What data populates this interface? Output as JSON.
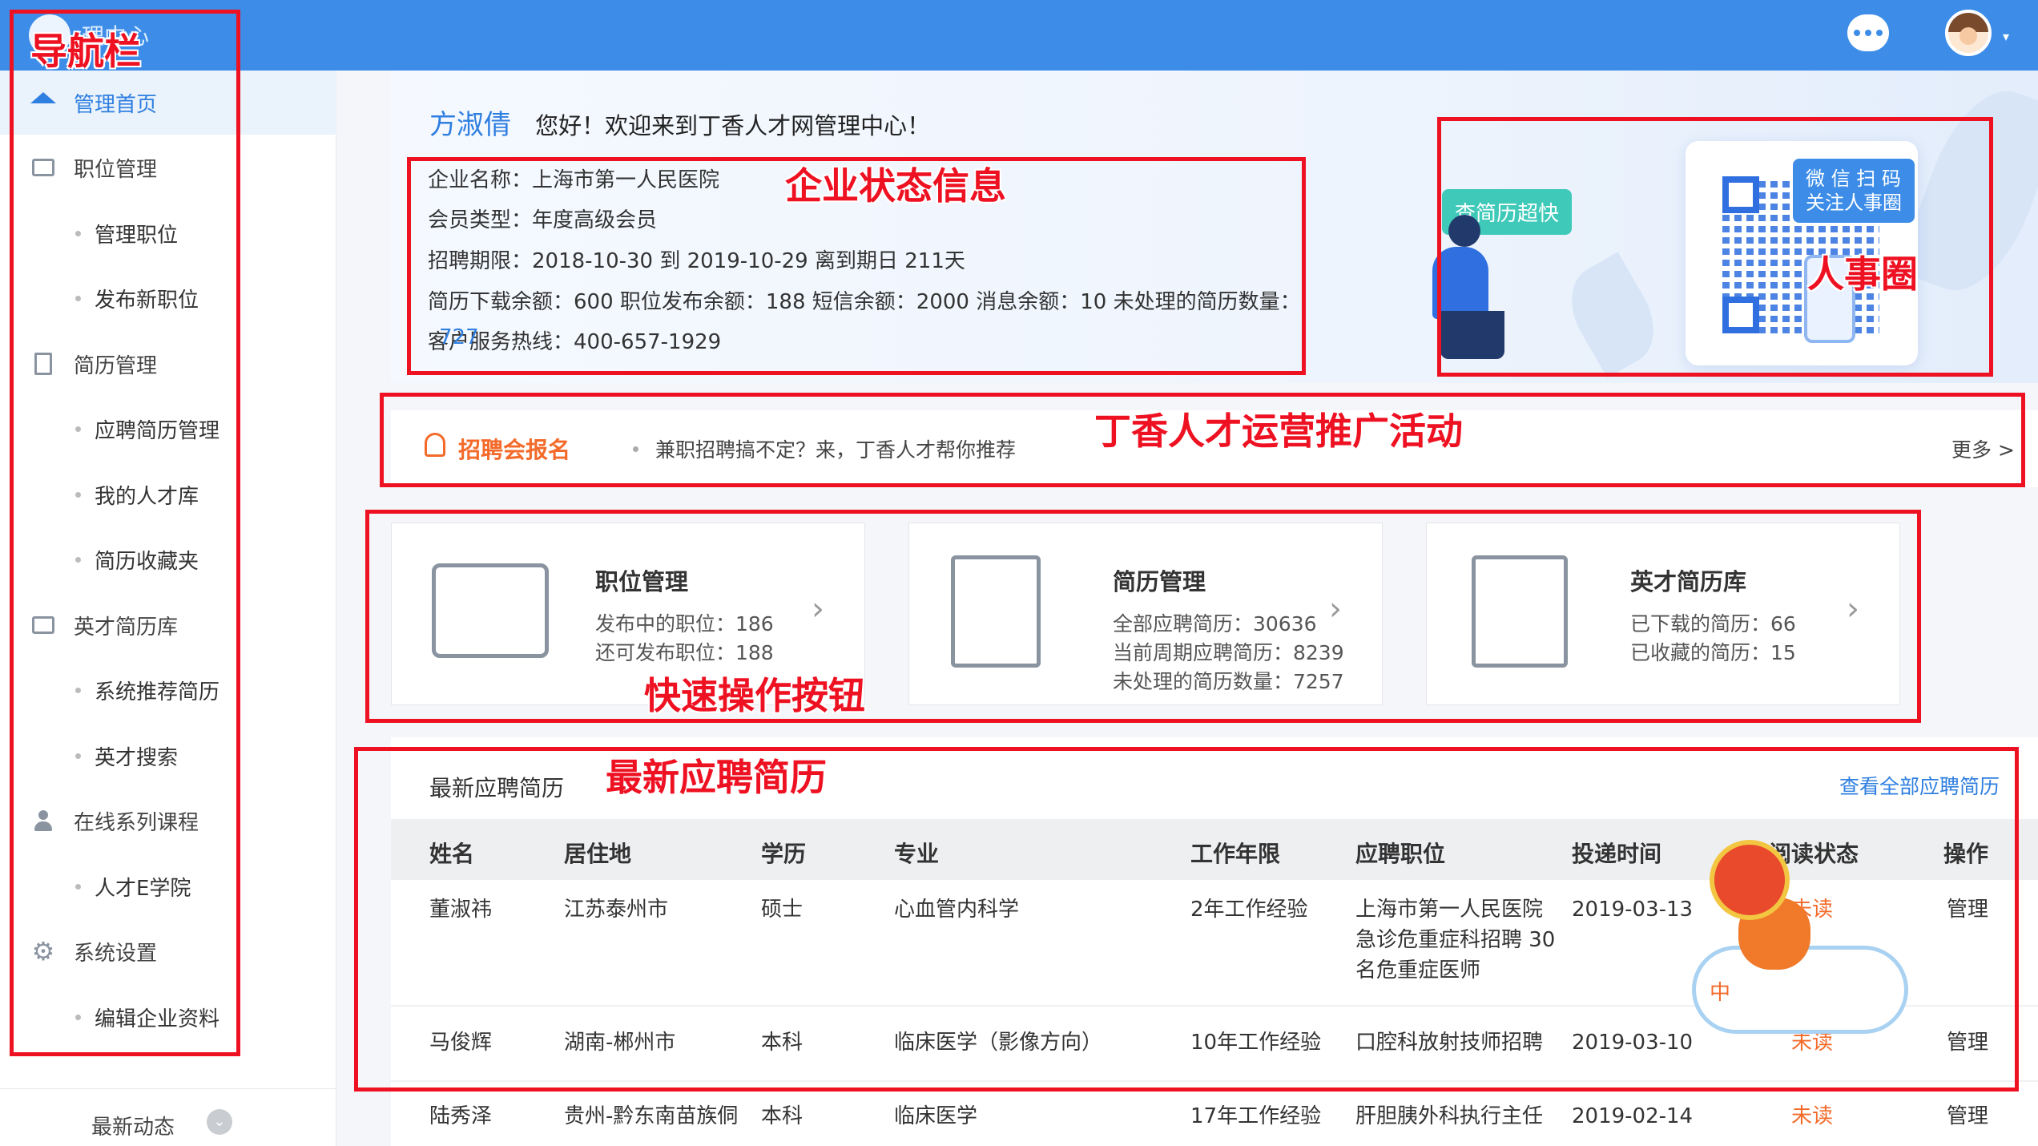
{
  "header": {
    "logo_text": "理中心"
  },
  "sidebar": {
    "items": [
      {
        "label": "管理首页"
      },
      {
        "label": "职位管理"
      },
      {
        "label": "管理职位"
      },
      {
        "label": "发布新职位"
      },
      {
        "label": "简历管理"
      },
      {
        "label": "应聘简历管理"
      },
      {
        "label": "我的人才库"
      },
      {
        "label": "简历收藏夹"
      },
      {
        "label": "英才简历库"
      },
      {
        "label": "系统推荐简历"
      },
      {
        "label": "英才搜索"
      },
      {
        "label": "在线系列课程"
      },
      {
        "label": "人才E学院"
      },
      {
        "label": "系统设置"
      },
      {
        "label": "编辑企业资料"
      }
    ],
    "latest_label": "最新动态"
  },
  "banner": {
    "user_name": "方淑倩",
    "welcome": "您好！欢迎来到丁香人才网管理中心！",
    "company": "企业名称：上海市第一人民医院",
    "member_type": "会员类型：年度高级会员",
    "recruit_period": "招聘期限：2018-10-30 到 2019-10-29 离到期日 211天",
    "balances": "简历下载余额：600  职位发布余额：188  短信余额：2000  消息余额：10  未处理的简历数量：",
    "hotline_prefix": "客户",
    "hotline_overlap": "727",
    "hotline": "服务热线：400-657-1929",
    "tag_fast": "查简历超快",
    "tag_wechat_line1": "微 信 扫 码",
    "tag_wechat_line2": "关注人事圈"
  },
  "promo": {
    "title": "招聘会报名",
    "text": "兼职招聘搞不定？来，丁香人才帮你推荐",
    "more": "更多 >"
  },
  "quick_actions": [
    {
      "title": "职位管理",
      "lines": [
        "发布中的职位：186",
        "还可发布职位：188"
      ]
    },
    {
      "title": "简历管理",
      "lines": [
        "全部应聘简历：30636",
        "当前周期应聘简历：8239",
        "未处理的简历数量：7257"
      ]
    },
    {
      "title": "英才简历库",
      "lines": [
        "已下载的简历：66",
        "已收藏的简历：15"
      ]
    }
  ],
  "resumes": {
    "title": "最新应聘简历",
    "view_all": "查看全部应聘简历",
    "columns": [
      "姓名",
      "居住地",
      "学历",
      "专业",
      "工作年限",
      "应聘职位",
      "投递时间",
      "阅读状态",
      "操作"
    ],
    "rows": [
      {
        "name": "董淑祎",
        "location": "江苏泰州市",
        "edu": "硕士",
        "major": "心血管内科学",
        "years": "2年工作经验",
        "position_lines": [
          "上海市第一人民医院",
          "急诊危重症科招聘 30",
          "名危重症医师"
        ],
        "date": "2019-03-13",
        "status": "未读",
        "action": "管理"
      },
      {
        "name": "马俊辉",
        "location": "湖南-郴州市",
        "edu": "本科",
        "major": "临床医学（影像方向）",
        "years": "10年工作经验",
        "position_lines": [
          "口腔科放射技师招聘"
        ],
        "date": "2019-03-10",
        "status": "未读",
        "action": "管理"
      },
      {
        "name": "陆秀泽",
        "location": "贵州-黔东南苗族侗",
        "edu": "本科",
        "major": "临床医学",
        "years": "17年工作经验",
        "position_lines": [
          "肝胆胰外科执行主任"
        ],
        "date": "2019-02-14",
        "status": "未读",
        "action": "管理"
      }
    ]
  },
  "mascot": {
    "cloud_char": "中"
  },
  "annotations": {
    "nav": "导航栏",
    "company": "企业状态信息",
    "hr_circle": "人事圈",
    "promo": "丁香人才运营推广活动",
    "quick": "快速操作按钮",
    "latest": "最新应聘简历"
  },
  "colors": {
    "primary": "#3d8de8",
    "accent": "#f36a2a",
    "annotation": "#ee1122"
  }
}
